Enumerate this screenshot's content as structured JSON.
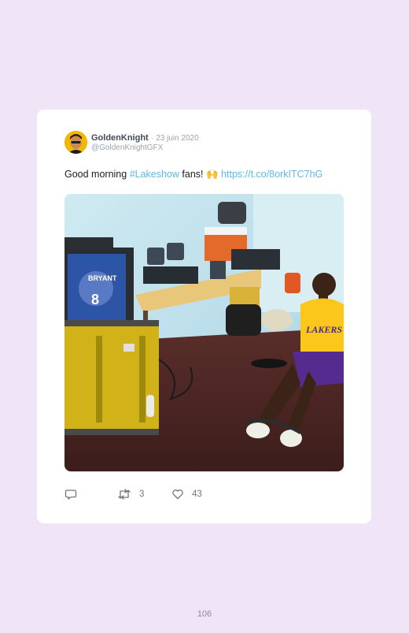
{
  "tweet": {
    "author_name": "GoldenKnight",
    "separator": "·",
    "date": "23 juin 2020",
    "handle": "@GoldenKnightGFX",
    "text_prefix": "Good morning ",
    "hashtag": "#Lakeshow",
    "text_middle": " fans! ",
    "emoji": "🙌",
    "link": "https://t.co/8orkITC7hG",
    "photo_jersey_text": "LAKERS",
    "photo_tv_text": "BRYANT",
    "photo_tv_number": "8"
  },
  "actions": {
    "reply_icon": "reply-icon",
    "retweet_icon": "retweet-icon",
    "retweet_count": "3",
    "like_icon": "heart-icon",
    "like_count": "43"
  },
  "footer": {
    "page_number": "106"
  },
  "colors": {
    "background": "#efe5f6",
    "card": "#ffffff",
    "link": "#5fb7e8",
    "name": "#3f4b58",
    "muted": "#9aa3ad"
  }
}
